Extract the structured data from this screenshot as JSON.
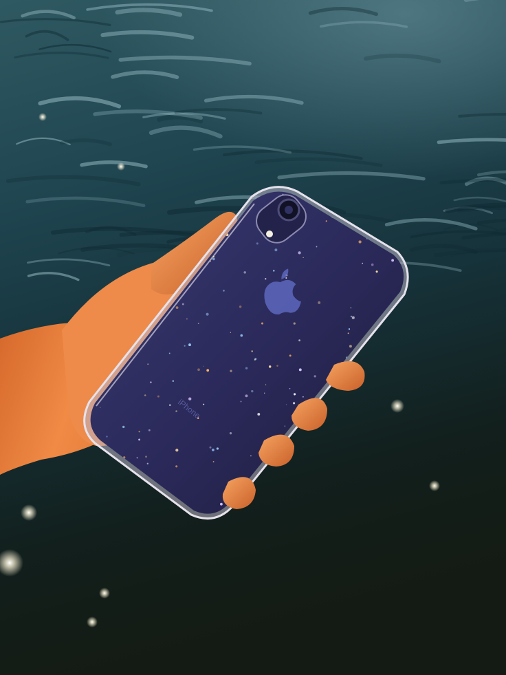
{
  "photo": {
    "subject": "hand-holding-phone-over-water",
    "phone": {
      "model_text": "iPhone",
      "body_color": "#2a2a6e",
      "case_style": "clear-glitter"
    },
    "colors": {
      "water_top": "#2f5962",
      "water_mid": "#16323a",
      "water_bottom": "#141b14",
      "skin_light": "#f29a55",
      "skin_dark": "#b8561f",
      "glitter_base": "#34325f",
      "case_rim": "#c9c4cf"
    }
  }
}
